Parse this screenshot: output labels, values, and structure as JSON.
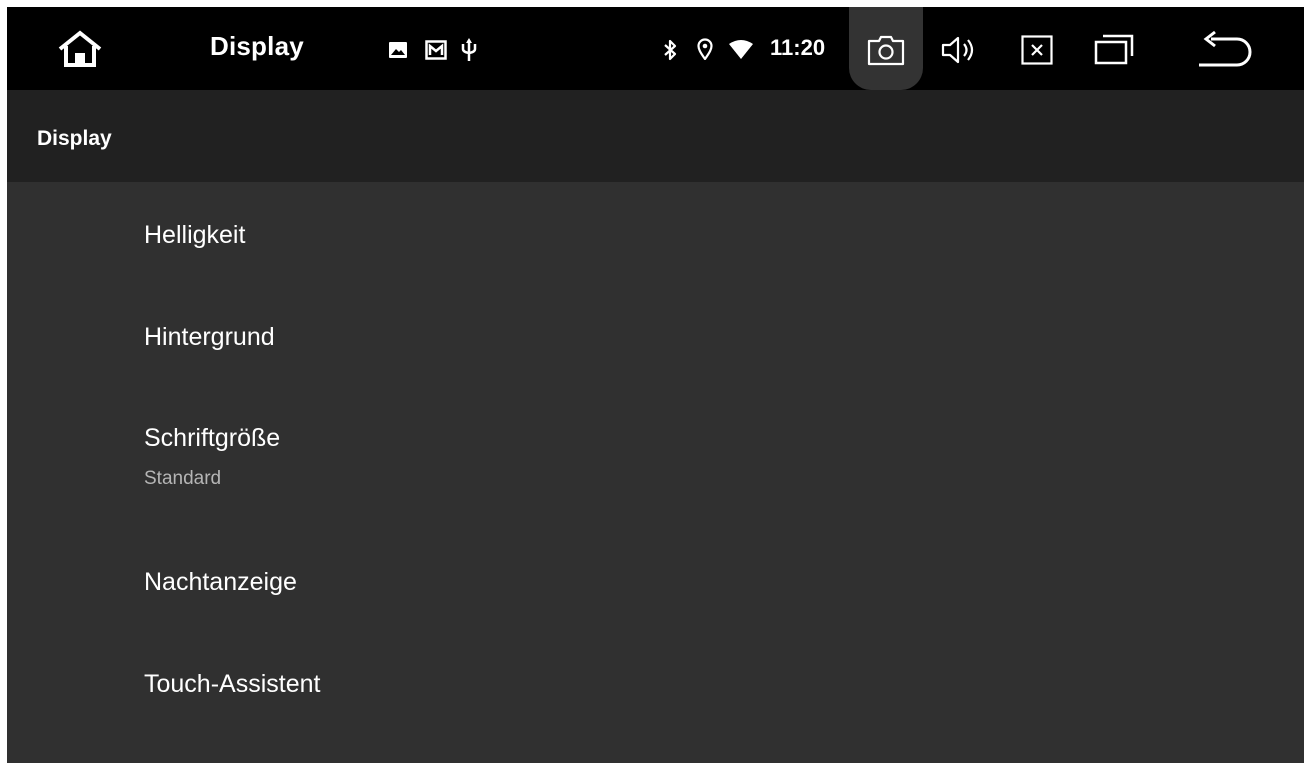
{
  "statusbar": {
    "title": "Display",
    "time": "11:20",
    "icons": [
      "home-icon",
      "image-icon",
      "mail-icon",
      "usb-icon",
      "bluetooth-icon",
      "location-icon",
      "wifi-icon",
      "screenshot-icon",
      "volume-icon",
      "close-icon",
      "recent-apps-icon",
      "back-icon"
    ]
  },
  "appbar": {
    "title": "Display"
  },
  "settings": {
    "items": [
      {
        "label": "Helligkeit"
      },
      {
        "label": "Hintergrund"
      },
      {
        "label": "Schriftgröße",
        "summary": "Standard"
      },
      {
        "label": "Nachtanzeige"
      },
      {
        "label": "Touch-Assistent"
      }
    ]
  },
  "colors": {
    "statusbar_bg": "#000000",
    "appbar_bg": "#212121",
    "content_bg": "#303030",
    "text_primary": "#ffffff",
    "text_secondary": "#b5b5b5"
  }
}
